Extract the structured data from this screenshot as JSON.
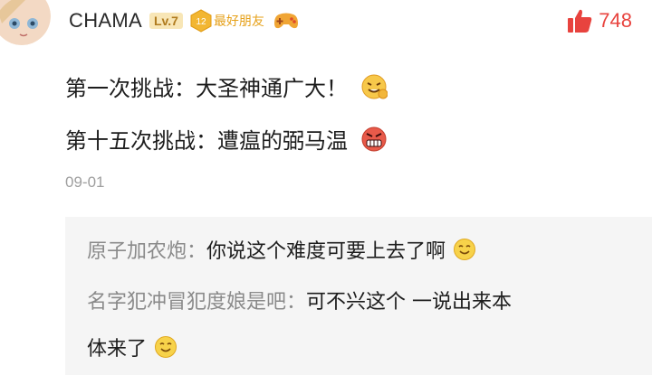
{
  "comment": {
    "username": "CHAMA",
    "level": "Lv.7",
    "friend_level": "12",
    "friend_label": "最好朋友",
    "likes": "748",
    "lines": [
      "第一次挑战：大圣神通广大！",
      "第十五次挑战：遭瘟的弼马温"
    ],
    "date": "09-01"
  },
  "replies": [
    {
      "author": "原子加农炮",
      "text": "你说这个难度可要上去了啊"
    },
    {
      "author": "名字犯冲冒犯度娘是吧",
      "text": "可不兴这个 一说出来本"
    },
    {
      "text_continued": "体来了"
    }
  ],
  "colors": {
    "like": "#e8433e",
    "level_bg": "#f8e6b6",
    "level_text": "#b07b1e",
    "friend": "#e6a11a",
    "reply_bg": "#f5f5f5",
    "reply_author": "#8a8a8a"
  },
  "icons": {
    "avatar": "anime-avatar",
    "friend": "hexagon-badge-icon",
    "game": "gamepad-icon",
    "like": "thumbs-up-icon",
    "emoji1": "grinning-fist-emoji-icon",
    "emoji2": "angry-emoji-icon",
    "smile": "smile-emoji-icon"
  }
}
